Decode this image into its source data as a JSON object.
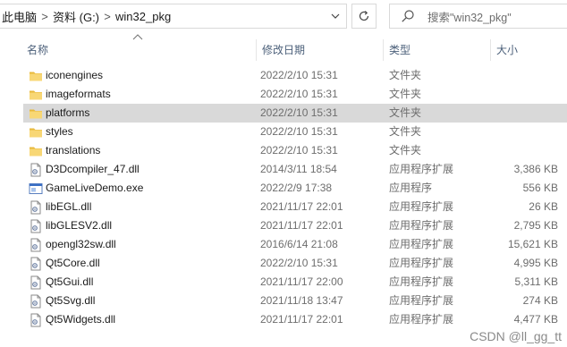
{
  "address_bar": {
    "breadcrumbs": [
      "此电脑",
      "资料 (G:)",
      "win32_pkg"
    ],
    "separator": ">"
  },
  "search": {
    "placeholder": "搜索\"win32_pkg\""
  },
  "columns": {
    "name": "名称",
    "date": "修改日期",
    "type": "类型",
    "size": "大小"
  },
  "files": [
    {
      "name": "iconengines",
      "date": "2022/2/10 15:31",
      "type": "文件夹",
      "size": "",
      "icon": "folder-icon",
      "selected": false
    },
    {
      "name": "imageformats",
      "date": "2022/2/10 15:31",
      "type": "文件夹",
      "size": "",
      "icon": "folder-icon",
      "selected": false
    },
    {
      "name": "platforms",
      "date": "2022/2/10 15:31",
      "type": "文件夹",
      "size": "",
      "icon": "folder-icon",
      "selected": true
    },
    {
      "name": "styles",
      "date": "2022/2/10 15:31",
      "type": "文件夹",
      "size": "",
      "icon": "folder-icon",
      "selected": false
    },
    {
      "name": "translations",
      "date": "2022/2/10 15:31",
      "type": "文件夹",
      "size": "",
      "icon": "folder-icon",
      "selected": false
    },
    {
      "name": "D3Dcompiler_47.dll",
      "date": "2014/3/11 18:54",
      "type": "应用程序扩展",
      "size": "3,386 KB",
      "icon": "dll-file-icon",
      "selected": false
    },
    {
      "name": "GameLiveDemo.exe",
      "date": "2022/2/9 17:38",
      "type": "应用程序",
      "size": "556 KB",
      "icon": "exe-file-icon",
      "selected": false
    },
    {
      "name": "libEGL.dll",
      "date": "2021/11/17 22:01",
      "type": "应用程序扩展",
      "size": "26 KB",
      "icon": "dll-file-icon",
      "selected": false
    },
    {
      "name": "libGLESV2.dll",
      "date": "2021/11/17 22:01",
      "type": "应用程序扩展",
      "size": "2,795 KB",
      "icon": "dll-file-icon",
      "selected": false
    },
    {
      "name": "opengl32sw.dll",
      "date": "2016/6/14 21:08",
      "type": "应用程序扩展",
      "size": "15,621 KB",
      "icon": "dll-file-icon",
      "selected": false
    },
    {
      "name": "Qt5Core.dll",
      "date": "2022/2/10 15:31",
      "type": "应用程序扩展",
      "size": "4,995 KB",
      "icon": "dll-file-icon",
      "selected": false
    },
    {
      "name": "Qt5Gui.dll",
      "date": "2021/11/17 22:00",
      "type": "应用程序扩展",
      "size": "5,311 KB",
      "icon": "dll-file-icon",
      "selected": false
    },
    {
      "name": "Qt5Svg.dll",
      "date": "2021/11/18 13:47",
      "type": "应用程序扩展",
      "size": "274 KB",
      "icon": "dll-file-icon",
      "selected": false
    },
    {
      "name": "Qt5Widgets.dll",
      "date": "2021/11/17 22:01",
      "type": "应用程序扩展",
      "size": "4,477 KB",
      "icon": "dll-file-icon",
      "selected": false
    }
  ],
  "watermark": "CSDN @ll_gg_tt",
  "colors": {
    "folder": "#f8d775",
    "folder_dark": "#e8b93c",
    "selection": "#d9d9d9",
    "header_text": "#4c607a",
    "muted_text": "#6d6d6d"
  }
}
